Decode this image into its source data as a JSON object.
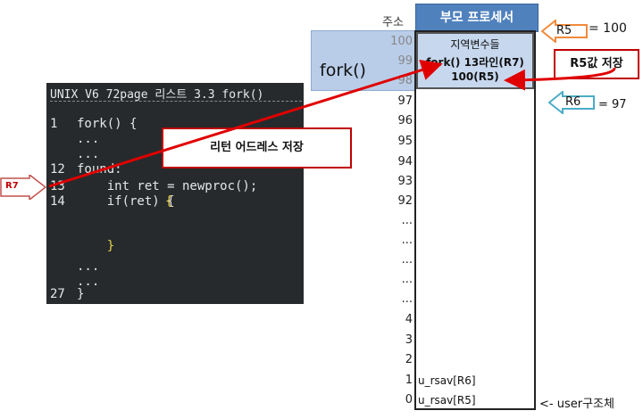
{
  "code": {
    "title": "UNIX V6 72page 리스트 3.3 fork()",
    "lines": [
      {
        "num": "1",
        "text": "fork() {"
      },
      {
        "num": "",
        "text": "..."
      },
      {
        "num": "",
        "text": "..."
      },
      {
        "num": "12",
        "text": "found:"
      },
      {
        "num": "13",
        "text": "    int ret = newproc();"
      },
      {
        "num": "14",
        "text": "    if(ret) {"
      },
      {
        "num": "",
        "text": "    }"
      },
      {
        "num": "",
        "text": "..."
      },
      {
        "num": "",
        "text": "..."
      },
      {
        "num": "27",
        "text": "}"
      }
    ],
    "open_brace": "{"
  },
  "labels": {
    "r7": "R7",
    "return_addr": "리턴 어드레스 저장",
    "r5_save": "R5값 저장",
    "r5": "R5",
    "r5_eq": "= 100",
    "r6": "R6",
    "r6_eq": "= 97",
    "user_struct": "<- user구조체",
    "fork_big": "fork()"
  },
  "stack": {
    "header": "부모 프로세서",
    "addr_header": "주소",
    "locals": [
      "지역변수들",
      "fork() 13라인(R7)",
      "100(R5)"
    ],
    "addresses": [
      "100",
      "99",
      "98",
      "97",
      "96",
      "95",
      "94",
      "93",
      "92",
      "...",
      "...",
      "...",
      "...",
      "...",
      "4",
      "3",
      "2",
      "1",
      "0"
    ],
    "slot1": "u_rsav[R6]",
    "slot0": "u_rsav[R5]"
  },
  "colors": {
    "header": "#4f81bd",
    "locals_bg": "#b9cde8",
    "arrow_red": "#e00000",
    "r5_arrow": "#f28a3c",
    "r6_arrow": "#4bacc6",
    "code_bg": "#262a2d"
  }
}
